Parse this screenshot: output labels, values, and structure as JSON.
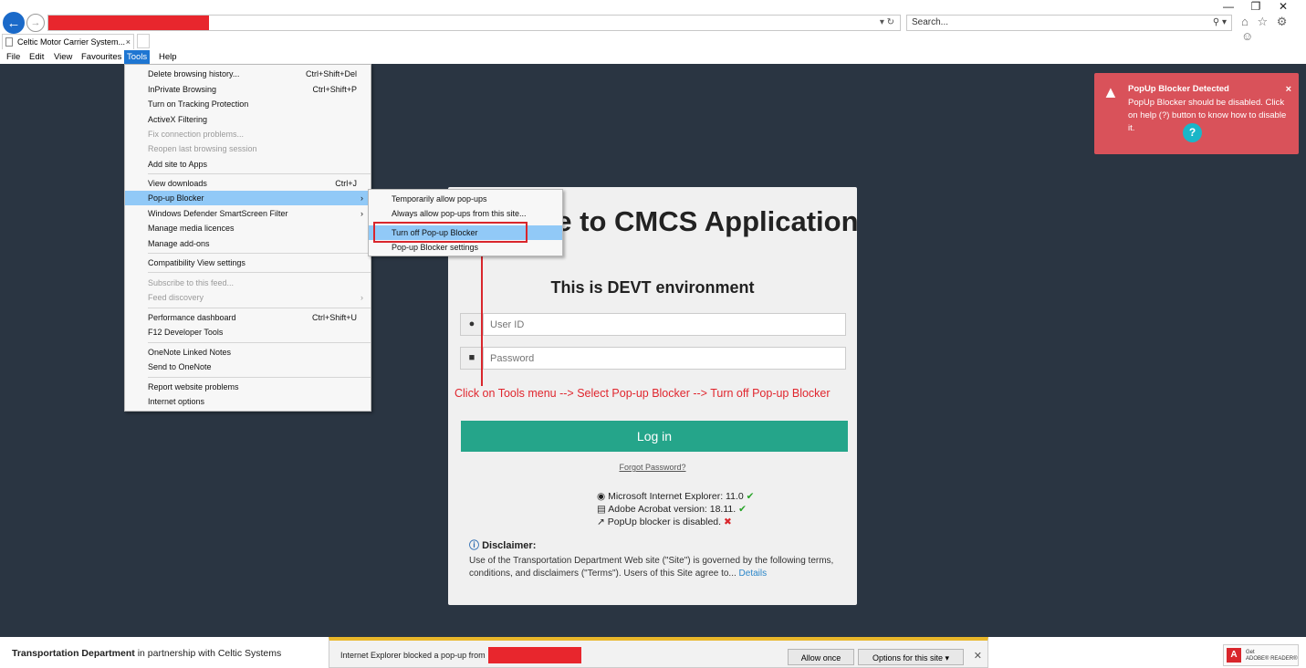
{
  "browser": {
    "search_placeholder": "Search...",
    "tab_title": "Celtic Motor Carrier System...",
    "tab_close": "×",
    "url_icons": "▾ ↻",
    "search_icons": "⚲ ▾",
    "tool_icons": "⌂ ☆ ⚙ ☺",
    "win_minimize": "—",
    "win_restore": "❐",
    "win_close": "✕"
  },
  "menubar": {
    "items": [
      "File",
      "Edit",
      "View",
      "Favourites",
      "Tools",
      "Help"
    ]
  },
  "tools_menu": {
    "items": [
      {
        "label": "Delete browsing history...",
        "shortcut": "Ctrl+Shift+Del"
      },
      {
        "label": "InPrivate Browsing",
        "shortcut": "Ctrl+Shift+P"
      },
      {
        "label": "Turn on Tracking Protection",
        "shortcut": ""
      },
      {
        "label": "ActiveX Filtering",
        "shortcut": ""
      },
      {
        "label": "Fix connection problems...",
        "shortcut": ""
      },
      {
        "label": "Reopen last browsing session",
        "shortcut": ""
      },
      {
        "label": "Add site to Apps",
        "shortcut": ""
      },
      {
        "label": "View downloads",
        "shortcut": "Ctrl+J"
      },
      {
        "label": "Pop-up Blocker",
        "shortcut": ""
      },
      {
        "label": "Windows Defender SmartScreen Filter",
        "shortcut": ""
      },
      {
        "label": "Manage media licences",
        "shortcut": ""
      },
      {
        "label": "Manage add-ons",
        "shortcut": ""
      },
      {
        "label": "Compatibility View settings",
        "shortcut": ""
      },
      {
        "label": "Subscribe to this feed...",
        "shortcut": ""
      },
      {
        "label": "Feed discovery",
        "shortcut": ""
      },
      {
        "label": "Performance dashboard",
        "shortcut": "Ctrl+Shift+U"
      },
      {
        "label": "F12 Developer Tools",
        "shortcut": ""
      },
      {
        "label": "OneNote Linked Notes",
        "shortcut": ""
      },
      {
        "label": "Send to OneNote",
        "shortcut": ""
      },
      {
        "label": "Report website problems",
        "shortcut": ""
      },
      {
        "label": "Internet options",
        "shortcut": ""
      }
    ]
  },
  "popup_submenu": {
    "items": [
      "Temporarily allow pop-ups",
      "Always allow pop-ups from this site...",
      "Turn off Pop-up Blocker",
      "Pop-up Blocker settings"
    ]
  },
  "login": {
    "welcome": "Welcome to CMCS Application",
    "environment": "This is DEVT environment",
    "userid_placeholder": "User ID",
    "password_placeholder": "Password",
    "login_button": "Log in",
    "forgot": "Forgot Password?",
    "checks": [
      {
        "text": "Microsoft Internet Explorer: 11.0",
        "status": "✔"
      },
      {
        "text": "Adobe Acrobat version: 18.11.",
        "status": "✔"
      },
      {
        "text": "PopUp blocker is disabled.",
        "status": "✖"
      }
    ],
    "disclaimer_title": "Disclaimer:",
    "disclaimer_text": "Use of the Transportation Department Web site (\"Site\") is governed by the following terms, conditions, and disclaimers (\"Terms\"). Users of this Site agree to...",
    "details_link": "Details"
  },
  "instruction": "Click on Tools menu --> Select Pop-up Blocker --> Turn off Pop-up Blocker",
  "toast": {
    "title": "PopUp Blocker Detected",
    "body": "PopUp Blocker should be disabled. Click on help (?) button to know how to disable it.",
    "close": "×",
    "help": "?"
  },
  "footer": {
    "brand": "Transportation Department",
    "tagline": " in partnership with Celtic Systems"
  },
  "notification": {
    "text": "Internet Explorer blocked a pop-up from",
    "allow_once": "Allow once",
    "options": "Options for this site ▾",
    "close": "✕"
  },
  "adobe_badge": {
    "logo": "A",
    "line1": "Get",
    "line2": "ADOBE® READER®"
  },
  "colors": {
    "page_bg": "#2a3542",
    "accent_green": "#25a58a",
    "toast_bg": "#d9525a",
    "menu_highlight": "#91c9f7",
    "annotation_red": "#d9262c"
  }
}
